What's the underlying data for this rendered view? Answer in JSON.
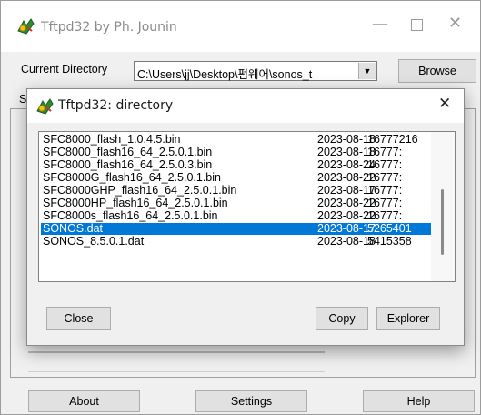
{
  "main_window": {
    "title": "Tftpd32 by Ph. Jounin",
    "minimize_glyph": "—",
    "close_glyph": "✕",
    "current_directory_label": "Current Directory",
    "current_directory_value": "C:\\Users\\jj\\Desktop\\펌웨어\\sonos_t",
    "dropdown_glyph": "▼",
    "browse_label": "Browse",
    "left_cutoff_label": "S",
    "about_label": "About",
    "settings_label": "Settings",
    "help_label": "Help"
  },
  "dialog": {
    "title": "Tftpd32: directory",
    "close_glyph": "✕",
    "files": [
      {
        "name": "SFC8000_flash_1.0.4.5.bin",
        "date": "2023-08-18",
        "size": "16777216"
      },
      {
        "name": "SFC8000_flash16_64_2.5.0.1.bin",
        "date": "2023-08-18",
        "size": "16777:"
      },
      {
        "name": "SFC8000_flash16_64_2.5.0.3.bin",
        "date": "2023-08-24",
        "size": "16777:"
      },
      {
        "name": "SFC8000G_flash16_64_2.5.0.1.bin",
        "date": "2023-08-22",
        "size": "16777:"
      },
      {
        "name": "SFC8000GHP_flash16_64_2.5.0.1.bin",
        "date": "2023-08-17",
        "size": "16777:"
      },
      {
        "name": "SFC8000HP_flash16_64_2.5.0.1.bin",
        "date": "2023-08-22",
        "size": "16777:"
      },
      {
        "name": "SFC8000s_flash16_64_2.5.0.1.bin",
        "date": "2023-08-22",
        "size": "16777:"
      },
      {
        "name": "SONOS.dat",
        "date": "2023-08-17",
        "size": "5265401",
        "selected": true
      },
      {
        "name": "SONOS_8.5.0.1.dat",
        "date": "2023-08-18",
        "size": "5415358"
      }
    ],
    "close_label": "Close",
    "copy_label": "Copy",
    "explorer_label": "Explorer"
  },
  "icons": [
    "app-icon",
    "minimize-icon",
    "maximize-icon",
    "close-icon",
    "dropdown-arrow-icon"
  ],
  "colors": {
    "selection": "#0078d7",
    "window_bg": "#f0f0f0",
    "titlebar_bg": "#ffffff",
    "button_bg": "#e1e1e1"
  }
}
